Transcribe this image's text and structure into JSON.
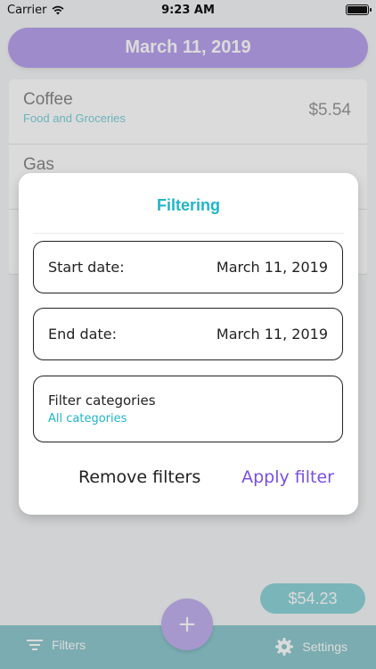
{
  "status_bar": {
    "carrier": "Carrier",
    "time": "9:23 AM",
    "battery_level": 1.0
  },
  "header": {
    "date": "March 11, 2019"
  },
  "expenses": [
    {
      "name": "Coffee",
      "category": "Food and Groceries",
      "amount": "$5.54"
    },
    {
      "name": "Gas",
      "category": "",
      "amount": ""
    },
    {
      "name": "",
      "category": "",
      "amount": ""
    }
  ],
  "filter_modal": {
    "title": "Filtering",
    "start_label": "Start date:",
    "start_value": "March 11, 2019",
    "end_label": "End date:",
    "end_value": "March 11, 2019",
    "categories_label": "Filter categories",
    "categories_value": "All categories",
    "remove_label": "Remove filters",
    "apply_label": "Apply filter"
  },
  "total": "$54.23",
  "bottom_bar": {
    "filters_label": "Filters",
    "settings_label": "Settings",
    "add_label": "+"
  },
  "colors": {
    "accent_purple": "#b8a2ee",
    "accent_teal": "#1fb5c9",
    "apply_purple": "#7b4fe0",
    "bar_teal": "#8ec9cf"
  }
}
